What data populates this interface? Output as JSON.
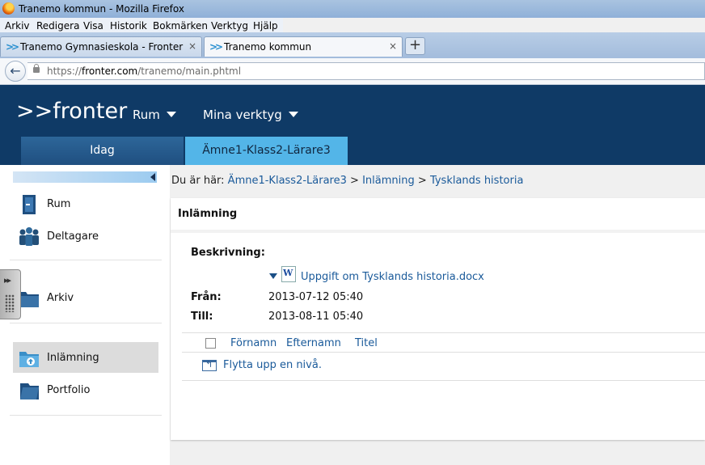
{
  "window": {
    "title": "Tranemo kommun - Mozilla Firefox"
  },
  "menubar": [
    "Arkiv",
    "Redigera",
    "Visa",
    "Historik",
    "Bokmärken",
    "Verktyg",
    "Hjälp"
  ],
  "tabs": [
    {
      "label": "Tranemo Gymnasieskola - Fronter"
    },
    {
      "label": "Tranemo kommun"
    }
  ],
  "newtab_label": "+",
  "tab_close": "×",
  "address": {
    "prefix": "https://",
    "domain": "fronter.com",
    "path": "/tranemo/main.phtml"
  },
  "fronter": {
    "logo": ">>fronter",
    "menu": [
      "Rum",
      "Mina verktyg"
    ],
    "tabs": [
      "Idag",
      "Ämne1-Klass2-Lärare3"
    ]
  },
  "sidebar": {
    "items": [
      {
        "label": "Rum",
        "icon": "door-icon"
      },
      {
        "label": "Deltagare",
        "icon": "people-icon"
      },
      {
        "label": "Arkiv",
        "icon": "folder-icon"
      },
      {
        "label": "Inlämning",
        "icon": "upload-folder-icon"
      },
      {
        "label": "Portfolio",
        "icon": "portfolio-icon"
      }
    ]
  },
  "breadcrumb": {
    "prefix": "Du är här:",
    "links": [
      "Ämne1-Klass2-Lärare3",
      "Inlämning",
      "Tysklands historia"
    ],
    "sep": ">"
  },
  "panel": {
    "title": "Inlämning",
    "description_label": "Beskrivning:",
    "file_name": "Uppgift om Tysklands historia.docx",
    "from_label": "Från:",
    "from_value": "2013-07-12 05:40",
    "to_label": "Till:",
    "to_value": "2013-08-11 05:40",
    "columns": [
      "Förnamn",
      "Efternamn",
      "Titel"
    ],
    "up_link": "Flytta upp en nivå."
  },
  "colors": {
    "header": "#0f3a66",
    "active_tab": "#53b5e8",
    "link": "#1a5a9a"
  }
}
